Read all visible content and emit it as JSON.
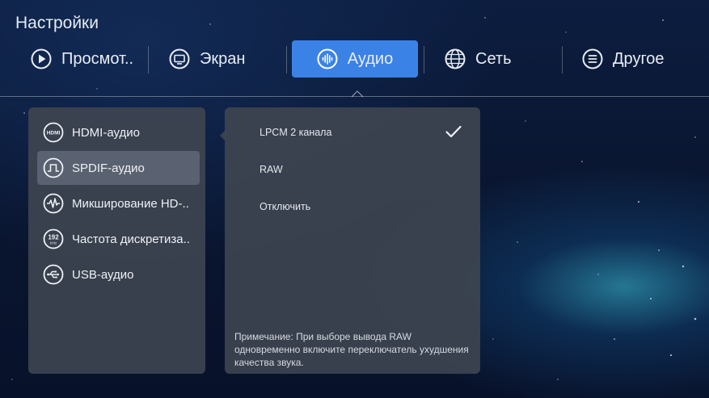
{
  "header": {
    "title": "Настройки"
  },
  "tabs": [
    {
      "label": "Просмот..",
      "icon": "play-icon",
      "active": false
    },
    {
      "label": "Экран",
      "icon": "monitor-icon",
      "active": false
    },
    {
      "label": "Аудио",
      "icon": "audio-wave-icon",
      "active": true
    },
    {
      "label": "Сеть",
      "icon": "globe-icon",
      "active": false
    },
    {
      "label": "Другое",
      "icon": "menu-icon",
      "active": false
    }
  ],
  "audio_menu": {
    "items": [
      {
        "label": "HDMI-аудио",
        "icon": "hdmi-icon",
        "selected": false
      },
      {
        "label": "SPDIF-аудио",
        "icon": "spdif-icon",
        "selected": true
      },
      {
        "label": "Микширование HD-..",
        "icon": "waveform-icon",
        "selected": false
      },
      {
        "label": "Частота дискретиза..",
        "icon": "sample-rate-192khz-icon",
        "selected": false
      },
      {
        "label": "USB-аудио",
        "icon": "usb-icon",
        "selected": false
      }
    ]
  },
  "options": {
    "items": [
      {
        "label": "LPCM 2 канала",
        "checked": true
      },
      {
        "label": "RAW",
        "checked": false
      },
      {
        "label": "Отключить",
        "checked": false
      }
    ],
    "note": "Примечание: При выборе вывода RAW одновременно включите переключатель ухудшения качества звука."
  },
  "colors": {
    "accent": "#3b82e6",
    "panel": "#3e4450",
    "selected_item": "#5a6170"
  },
  "icon_texts": {
    "hdmi": "HDMI",
    "rate_top": "192",
    "rate_bottom": "KHz"
  }
}
